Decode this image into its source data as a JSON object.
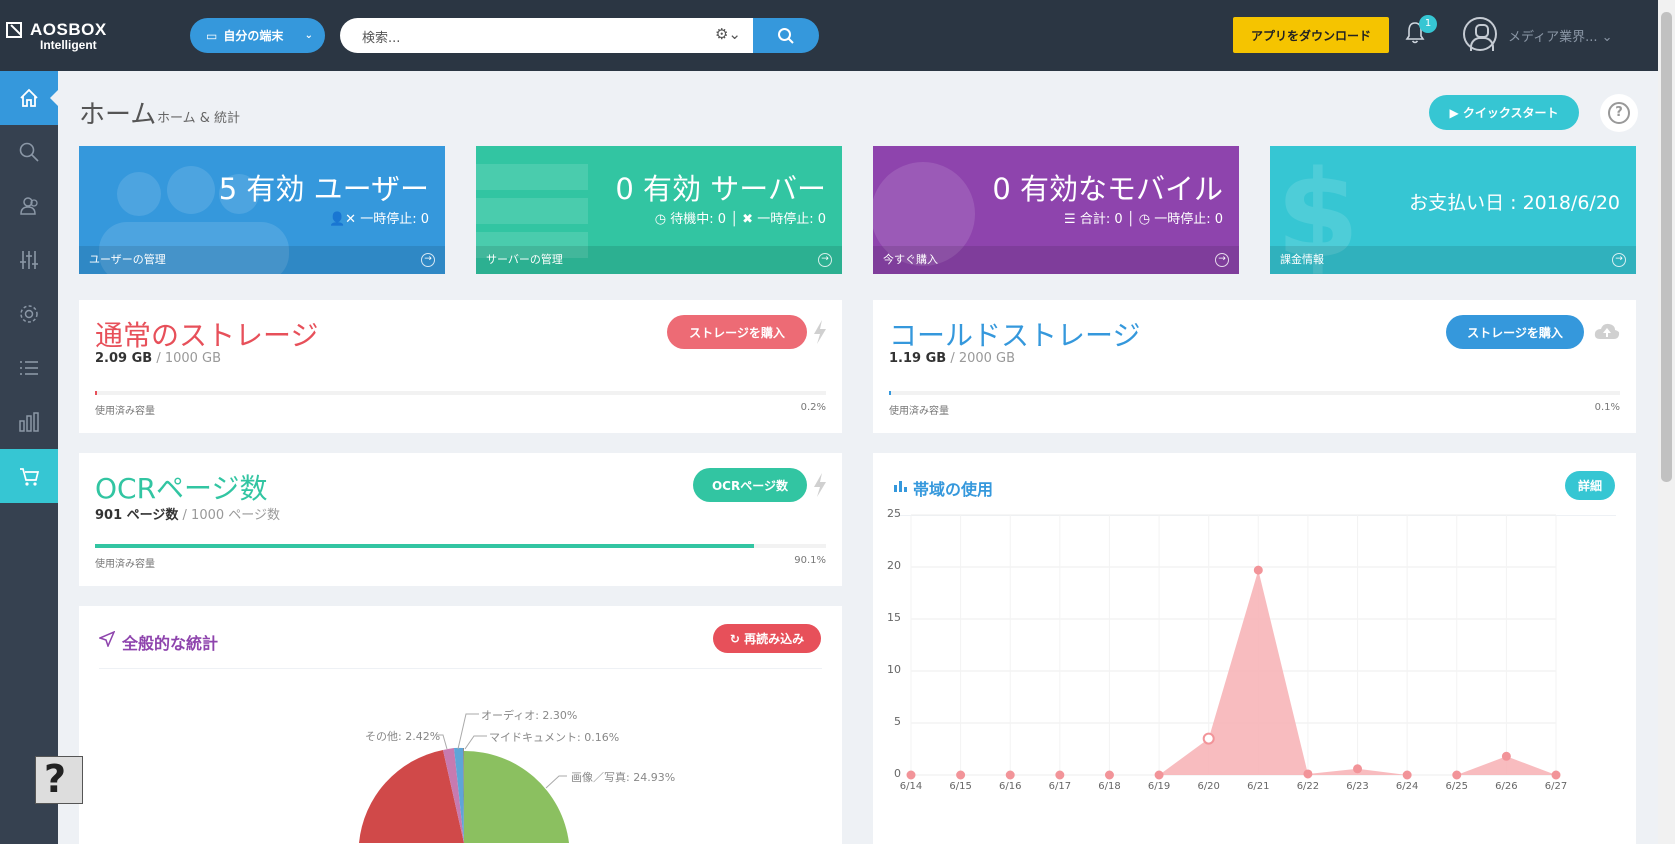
{
  "brand": {
    "name": "AOSBOX",
    "sub": "Intelligent"
  },
  "header": {
    "device_label": "自分の端末",
    "search_placeholder": "検索...",
    "download_label": "アプリをダウンロード",
    "notification_count": "1",
    "user_name": "メディア業界..."
  },
  "sidebar": [
    {
      "name": "home",
      "icon": "home-icon",
      "active": true
    },
    {
      "name": "search",
      "icon": "search-icon"
    },
    {
      "name": "users",
      "icon": "users-icon"
    },
    {
      "name": "sliders",
      "icon": "sliders-icon"
    },
    {
      "name": "settings",
      "icon": "gear-icon"
    },
    {
      "name": "list",
      "icon": "list-icon"
    },
    {
      "name": "reports",
      "icon": "bar-chart-icon"
    },
    {
      "name": "cart",
      "icon": "cart-icon",
      "active": true
    }
  ],
  "page": {
    "title": "ホーム",
    "subtitle": "ホーム & 統計",
    "quickstart_label": "▶ クイックスタート",
    "help": "?"
  },
  "tiles": {
    "users": {
      "big": "5 有効 ユーザー",
      "small": "一時停止: 0",
      "link": "ユーザーの管理",
      "color": "#3598dc"
    },
    "servers": {
      "big": "0 有効 サーバー",
      "waiting": "待機中: 0",
      "paused": "一時停止: 0",
      "link": "サーバーの管理",
      "color": "#32c5a2"
    },
    "mobile": {
      "big": "0 有効なモバイル",
      "total": "合計: 0",
      "paused": "一時停止: 0",
      "link": "今すぐ購入",
      "color": "#8e44ad"
    },
    "billing": {
      "big": "お支払い日 : 2018/6/20",
      "link": "課金情報",
      "color": "#36c6d3"
    }
  },
  "storage": {
    "normal": {
      "title": "通常のストレージ",
      "used": "2.09 GB",
      "total": " / 1000 GB",
      "button": "ストレージを購入",
      "label": "使用済み容量",
      "pct": "0.2%",
      "fraction": 0.002,
      "color": "#e7505a"
    },
    "cold": {
      "title": "コールドストレージ",
      "used": "1.19 GB",
      "total": " / 2000 GB",
      "button": "ストレージを購入",
      "label": "使用済み容量",
      "pct": "0.1%",
      "fraction": 0.001,
      "color": "#3598dc"
    },
    "ocr": {
      "title": "OCRページ数",
      "used": "901 ページ数",
      "total": " / 1000 ページ数",
      "button": "OCRページ数",
      "label": "使用済み容量",
      "pct": "90.1%",
      "fraction": 0.901,
      "color": "#32c5a2"
    }
  },
  "stats": {
    "title": "全般的な統計",
    "reload": "再読み込み",
    "pie_labels": {
      "audio": "オーディオ: 2.30%",
      "documents": "マイドキュメント: 0.16%",
      "other": "その他: 2.42%",
      "images": "画像／写真: 24.93%"
    }
  },
  "bandwidth": {
    "title": "帯域の使用",
    "details": "詳細"
  },
  "chart_data": {
    "type": "area",
    "title": "帯域の使用",
    "categories": [
      "6/14",
      "6/15",
      "6/16",
      "6/17",
      "6/18",
      "6/19",
      "6/20",
      "6/21",
      "6/22",
      "6/23",
      "6/24",
      "6/25",
      "6/26",
      "6/27"
    ],
    "series": [
      {
        "values": [
          0,
          0,
          0,
          0,
          0,
          0,
          3.5,
          19.7,
          0.1,
          0.6,
          0,
          0,
          1.8,
          0
        ]
      }
    ],
    "yticks": [
      "0",
      "5",
      "10",
      "15",
      "20",
      "25"
    ],
    "ylim": [
      0,
      25
    ],
    "color": "#f7b0b4"
  }
}
